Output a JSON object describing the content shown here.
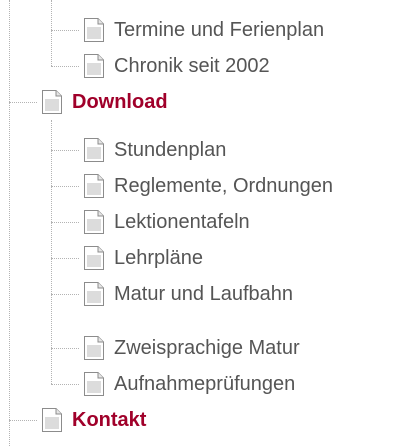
{
  "tree": {
    "items": [
      {
        "label": "Termine und Ferienplan",
        "level": 2,
        "section": false
      },
      {
        "label": "Chronik seit 2002",
        "level": 2,
        "section": false
      },
      {
        "label": "Download",
        "level": 1,
        "section": true
      },
      {
        "label": "Stundenplan",
        "level": 2,
        "section": false
      },
      {
        "label": "Reglemente, Ordnungen",
        "level": 2,
        "section": false
      },
      {
        "label": "Lektionentafeln",
        "level": 2,
        "section": false
      },
      {
        "label": "Lehrpläne",
        "level": 2,
        "section": false
      },
      {
        "label": "Matur und Laufbahn",
        "level": 2,
        "section": false
      },
      {
        "label": "Zweisprachige Matur",
        "level": 2,
        "section": false
      },
      {
        "label": "Aufnahmeprüfungen",
        "level": 2,
        "section": false
      },
      {
        "label": "Kontakt",
        "level": 1,
        "section": true
      }
    ],
    "icon": "document-icon"
  },
  "colors": {
    "section_link": "#a0002a",
    "item_link": "#555555",
    "tree_line": "#b3b3b3"
  }
}
